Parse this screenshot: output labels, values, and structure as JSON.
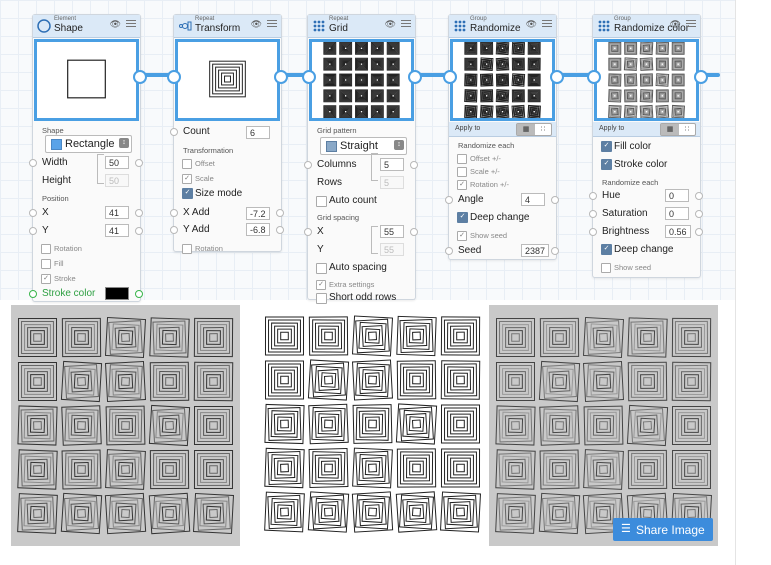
{
  "nodes": {
    "shape": {
      "category": "Element",
      "title": "Shape",
      "shape_label": "Shape",
      "shape_value": "Rectangle",
      "width_label": "Width",
      "width_value": "50",
      "height_label": "Height",
      "height_value": "50",
      "position_label": "Position",
      "x_label": "X",
      "x_value": "41",
      "y_label": "Y",
      "y_value": "41",
      "rotation_label": "Rotation",
      "fill_label": "Fill",
      "stroke_label": "Stroke",
      "stroke_color_label": "Stroke color",
      "stroke_color": "#000000"
    },
    "transform": {
      "category": "Repeat",
      "title": "Transform",
      "count_label": "Count",
      "count_value": "6",
      "transformation_label": "Transformation",
      "offset_label": "Offset",
      "scale_label": "Scale",
      "size_mode_label": "Size mode",
      "xadd_label": "X Add",
      "xadd_value": "-7.2",
      "yadd_label": "Y Add",
      "yadd_value": "-6.8",
      "rotation_label": "Rotation"
    },
    "grid": {
      "category": "Repeat",
      "title": "Grid",
      "pattern_label": "Grid pattern",
      "pattern_value": "Straight",
      "columns_label": "Columns",
      "columns_value": "5",
      "rows_label": "Rows",
      "rows_value": "5",
      "auto_count_label": "Auto count",
      "spacing_label": "Grid spacing",
      "x_label": "X",
      "x_value": "55",
      "y_label": "Y",
      "y_value": "55",
      "auto_spacing_label": "Auto spacing",
      "extra_label": "Extra settings",
      "short_odd_rows_label": "Short odd rows"
    },
    "randomize": {
      "category": "Group",
      "title": "Randomize",
      "apply_to_label": "Apply to",
      "randomize_each_label": "Randomize each",
      "offset_label": "Offset +/-",
      "scale_label": "Scale +/-",
      "rotation_label": "Rotation +/-",
      "angle_label": "Angle",
      "angle_value": "4",
      "deep_change_label": "Deep change",
      "show_seed_label": "Show seed",
      "seed_label": "Seed",
      "seed_value": "2387"
    },
    "randomize_color": {
      "category": "Group",
      "title": "Randomize color",
      "apply_to_label": "Apply to",
      "fill_color_label": "Fill color",
      "stroke_color_label": "Stroke color",
      "randomize_each_label": "Randomize each",
      "hue_label": "Hue",
      "hue_value": "0",
      "saturation_label": "Saturation",
      "saturation_value": "0",
      "brightness_label": "Brightness",
      "brightness_value": "0.56",
      "deep_change_label": "Deep change",
      "show_seed_label": "Show seed"
    }
  },
  "share_button_label": "Share Image",
  "colors": {
    "accent": "#4a9fe3",
    "header": "#dbe9f7",
    "share": "#3c8cdc"
  },
  "gallery_backgrounds": [
    "#c9c9c9",
    "#ffffff",
    "#c9c9c9"
  ]
}
